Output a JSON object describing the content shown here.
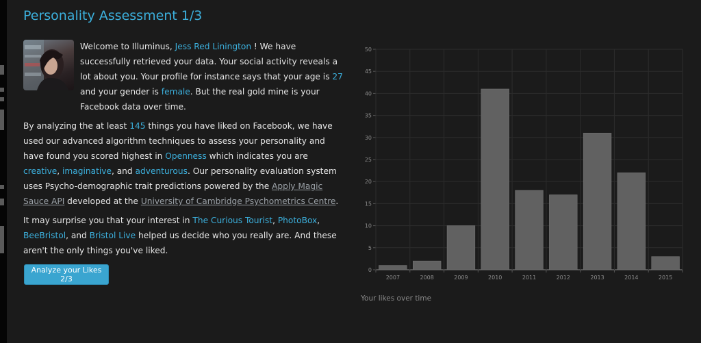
{
  "page": {
    "title": "Personality Assessment 1/3"
  },
  "profile": {
    "name": "Jess Red Linington",
    "age": "27",
    "gender": "female",
    "likes_count": "145"
  },
  "text": {
    "p1_a": "Welcome to Illuminus, ",
    "p1_b": " ! We have successfully retrieved your data. Your social activity reveals a lot about you. Your profile for instance says that your age is ",
    "p1_c": " and your gender is ",
    "p1_d": ". But the real gold mine is your Facebook data over time.",
    "p2_a": "By analyzing the at least ",
    "p2_b": " things you have liked on Facebook, we have used our advanced algorithm techniques to assess your personality and have found you scored highest in ",
    "trait": "Openness",
    "p2_c": " which indicates you are ",
    "adj1": "creative",
    "p2_d": ", ",
    "adj2": "imaginative",
    "p2_e": ", and ",
    "adj3": "adventurous",
    "p2_f": ". Our personality evaluation system uses Psycho-demographic trait predictions powered by the ",
    "link_api": "Apply Magic Sauce API",
    "p2_g": " developed at the ",
    "link_uni": "University of Cambridge Psychometrics Centre",
    "p2_h": ".",
    "p3_a": "It may surprise you that your interest in ",
    "like1": "The Curious Tourist",
    "sep1": ", ",
    "like2": "PhotoBox",
    "sep2": ", ",
    "like3": "BeeBristol",
    "p3_b": ", and ",
    "like4": "Bristol Live",
    "p3_c": " helped us decide who you really are. And these aren't the only things you've liked."
  },
  "button": {
    "label": "Analyze your Likes 2/3"
  },
  "colors": {
    "accent": "#3cb0dd",
    "button": "#3aa5d0",
    "bar": "#616161",
    "background": "#1b1b1b"
  },
  "chart_data": {
    "type": "bar",
    "title": "",
    "caption": "Your likes over time",
    "categories": [
      "2007",
      "2008",
      "2009",
      "2010",
      "2011",
      "2012",
      "2013",
      "2014",
      "2015"
    ],
    "values": [
      1,
      2,
      10,
      41,
      18,
      17,
      31,
      22,
      3
    ],
    "ylim": [
      0,
      50
    ],
    "yticks": [
      0,
      5,
      10,
      15,
      20,
      25,
      30,
      35,
      40,
      45,
      50
    ],
    "grid": true,
    "legend": "none"
  }
}
